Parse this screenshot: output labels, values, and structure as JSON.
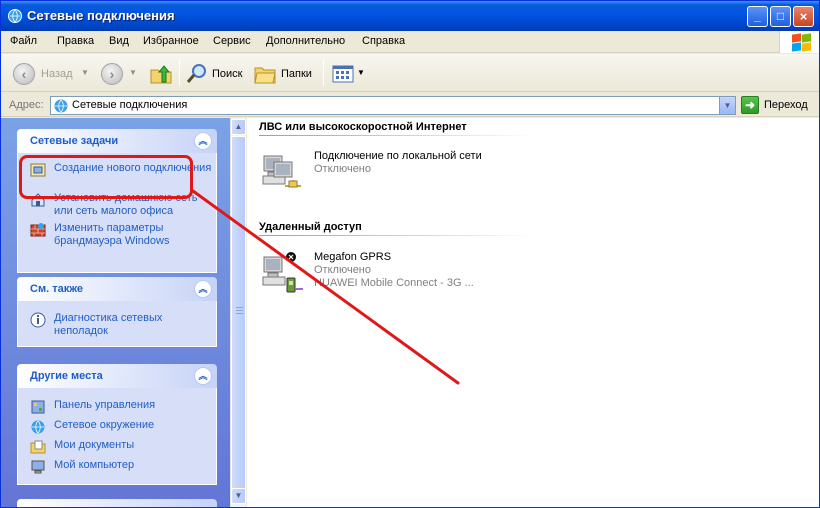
{
  "window": {
    "title": "Сетевые подключения"
  },
  "menubar": {
    "items": [
      "Файл",
      "Правка",
      "Вид",
      "Избранное",
      "Сервис",
      "Дополнительно",
      "Справка"
    ]
  },
  "toolbar": {
    "back_label": "Назад",
    "search_label": "Поиск",
    "folders_label": "Папки"
  },
  "address": {
    "label": "Адрес:",
    "value": "Сетевые подключения",
    "go_label": "Переход"
  },
  "sidebar": {
    "network_tasks": {
      "title": "Сетевые задачи",
      "items": [
        "Создание нового подключения",
        "Установить домашнюю сеть или сеть малого офиса",
        "Изменить параметры брандмауэра Windows"
      ]
    },
    "see_also": {
      "title": "См. также",
      "items": [
        "Диагностика сетевых неполадок"
      ]
    },
    "other_places": {
      "title": "Другие места",
      "items": [
        "Панель управления",
        "Сетевое окружение",
        "Мои документы",
        "Мой компьютер"
      ]
    }
  },
  "main": {
    "groups": [
      {
        "title": "ЛВС или высокоскоростной Интернет",
        "connections": [
          {
            "name": "Подключение по локальной сети",
            "status": "Отключено",
            "device": ""
          }
        ]
      },
      {
        "title": "Удаленный доступ",
        "connections": [
          {
            "name": "Megafon GPRS",
            "status": "Отключено",
            "device": "HUAWEI Mobile Connect - 3G ..."
          }
        ]
      }
    ]
  },
  "colors": {
    "titlebar": "#0054e3",
    "task_link": "#215dc6",
    "annotation": "#e01818"
  }
}
